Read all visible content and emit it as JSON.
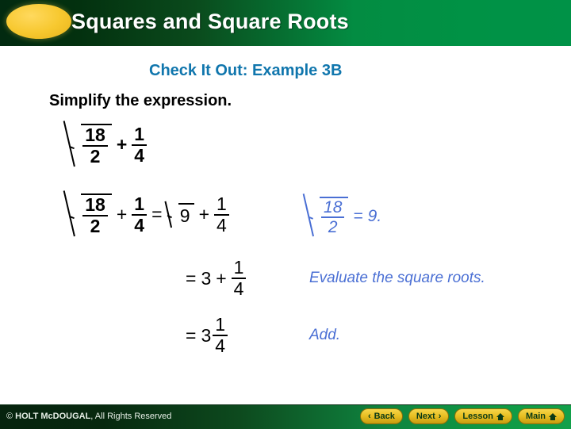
{
  "header": {
    "title": "Squares and Square Roots",
    "badge_icon": "ellipse-badge-icon",
    "bg_left": "#022a10",
    "bg_right": "#009247",
    "badge_color": "#f3c62a"
  },
  "content": {
    "example_heading": "Check It Out: Example 3B",
    "example_heading_color": "#1076ad",
    "instruction": "Simplify the expression.",
    "statement": {
      "radicand_numerator": "18",
      "radicand_denominator": "2",
      "plus": "+",
      "addend_numerator": "1",
      "addend_denominator": "4"
    },
    "steps": [
      {
        "lhs_radicand_numerator": "18",
        "lhs_radicand_denominator": "2",
        "plus": "+",
        "lhs_addend_numerator": "1",
        "lhs_addend_denominator": "4",
        "equals": "=",
        "rhs_radicand": "9",
        "rhs_plus": "+",
        "rhs_addend_numerator": "1",
        "rhs_addend_denominator": "4",
        "note": {
          "radicand_numerator": "18",
          "radicand_denominator": "2",
          "equals": "=",
          "value": "9."
        }
      },
      {
        "equals": "=",
        "whole": "3",
        "plus": "+",
        "numerator": "1",
        "denominator": "4",
        "note": "Evaluate the square roots."
      },
      {
        "equals": "=",
        "whole": "3",
        "numerator": "1",
        "denominator": "4",
        "note": "Add."
      }
    ],
    "note_color": "#4a6fd4"
  },
  "footer": {
    "copyright_symbol": "©",
    "copyright_strong": "HOLT McDOUGAL",
    "copyright_rest": ", All Rights Reserved",
    "buttons": [
      {
        "label": "Back",
        "icon": "chevron-left-icon",
        "glyph": "‹"
      },
      {
        "label": "Next",
        "icon": "chevron-right-icon",
        "glyph": "›"
      },
      {
        "label": "Lesson",
        "icon": "home-icon",
        "glyph": ""
      },
      {
        "label": "Main",
        "icon": "home-icon",
        "glyph": ""
      }
    ],
    "button_color": "#e8bf22",
    "bg_left": "#06230e",
    "bg_right": "#12a04a"
  }
}
